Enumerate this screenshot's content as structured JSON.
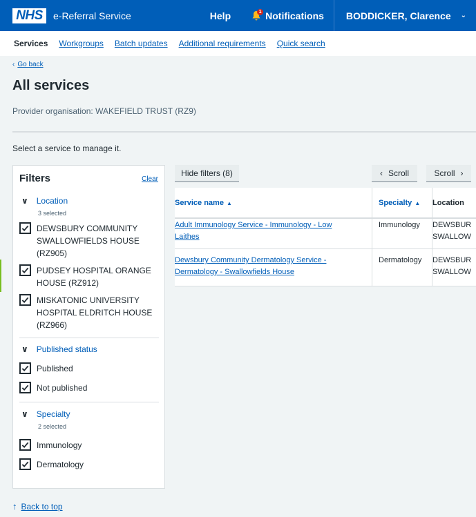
{
  "header": {
    "logo": "NHS",
    "service_name": "e-Referral Service",
    "help": "Help",
    "notifications": "Notifications",
    "notification_count": "1",
    "user": "BODDICKER, Clarence"
  },
  "subnav": {
    "items": [
      {
        "label": "Services",
        "active": true
      },
      {
        "label": "Workgroups"
      },
      {
        "label": "Batch updates"
      },
      {
        "label": "Additional requirements"
      },
      {
        "label": "Quick search"
      }
    ]
  },
  "page": {
    "go_back": "Go back",
    "title": "All services",
    "provider": "Provider organisation: WAKEFIELD TRUST (RZ9)",
    "hint": "Select a service to manage it.",
    "back_to_top": "Back to top"
  },
  "filters": {
    "heading": "Filters",
    "clear": "Clear",
    "location": {
      "title": "Location",
      "count": "3 selected",
      "options": [
        {
          "line1": "DEWSBURY COMMUNITY",
          "line2": "SWALLOWFIELDS HOUSE",
          "line3": "(RZ905)"
        },
        {
          "line1": "PUDSEY HOSPITAL ORANGE",
          "line2": "HOUSE (RZ912)"
        },
        {
          "line1": "MISKATONIC UNIVERSITY",
          "line2": "HOSPITAL ELDRITCH HOUSE",
          "line3": "(RZ966)"
        }
      ]
    },
    "published": {
      "title": "Published status",
      "options": [
        "Published",
        "Not published"
      ]
    },
    "specialty": {
      "title": "Specialty",
      "count": "2 selected",
      "options": [
        "Immunology",
        "Dermatology"
      ]
    }
  },
  "toolbar": {
    "hide_filters": "Hide filters (8)",
    "scroll_left": "Scroll",
    "scroll_right": "Scroll"
  },
  "table": {
    "columns": [
      "Service name",
      "Specialty",
      "Location"
    ],
    "rows": [
      {
        "name_l1": "Adult Immunology Service - Immunology - Low",
        "name_l2": "Laithes",
        "specialty": "Immunology",
        "loc_l1": "DEWSBUR",
        "loc_l2": "SWALLOW"
      },
      {
        "name_l1": "Dewsbury Community Dermatology Service -",
        "name_l2": "Dermatology - Swallowfields House",
        "specialty": "Dermatology",
        "loc_l1": "DEWSBUR",
        "loc_l2": "SWALLOW"
      }
    ]
  }
}
